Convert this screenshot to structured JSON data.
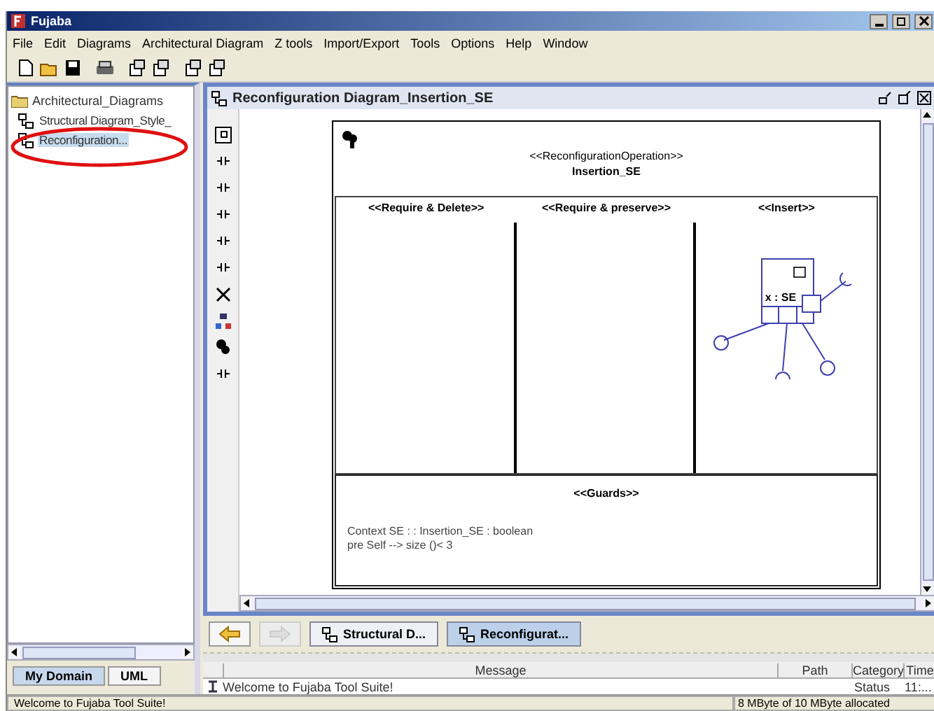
{
  "window": {
    "title": "Fujaba"
  },
  "menu": [
    "File",
    "Edit",
    "Diagrams",
    "Architectural Diagram",
    "Z tools",
    "Import/Export",
    "Tools",
    "Options",
    "Help",
    "Window"
  ],
  "tree": {
    "label": "Architectural_Diagrams",
    "children": [
      {
        "label": "Structural Diagram_Style_",
        "selected": false
      },
      {
        "label": "Reconfiguration...",
        "selected": true
      }
    ]
  },
  "left_tabs": [
    {
      "label": "My Domain",
      "selected": true
    },
    {
      "label": "UML",
      "selected": false
    }
  ],
  "editor": {
    "title": "Reconfiguration Diagram_Insertion_SE",
    "diagram": {
      "stereotype": "<<ReconfigurationOperation>>",
      "name": "Insertion_SE",
      "compartments": [
        "<<Require & Delete>>",
        "<<Require & preserve>>",
        "<<Insert>>"
      ],
      "node": "x : SE",
      "guards": {
        "title": "<<Guards>>",
        "lines": [
          "Context SE : : Insertion_SE : boolean",
          "pre Self --> size ()< 3"
        ]
      }
    }
  },
  "nav_buttons": [
    {
      "kind": "back",
      "disabled": false
    },
    {
      "kind": "forward",
      "disabled": true
    }
  ],
  "diagram_tabs": [
    {
      "label": "Structural D...",
      "selected": false
    },
    {
      "label": "Reconfigurat...",
      "selected": true
    }
  ],
  "messages": {
    "columns": [
      "Message",
      "Path",
      "Category",
      "Time"
    ],
    "rows": [
      {
        "message": "Welcome to Fujaba Tool Suite!",
        "category": "Status",
        "time": "11:..."
      }
    ]
  },
  "status_bar": {
    "left": "Welcome to Fujaba Tool Suite!",
    "right": "8 MByte of 10 MByte allocated"
  }
}
